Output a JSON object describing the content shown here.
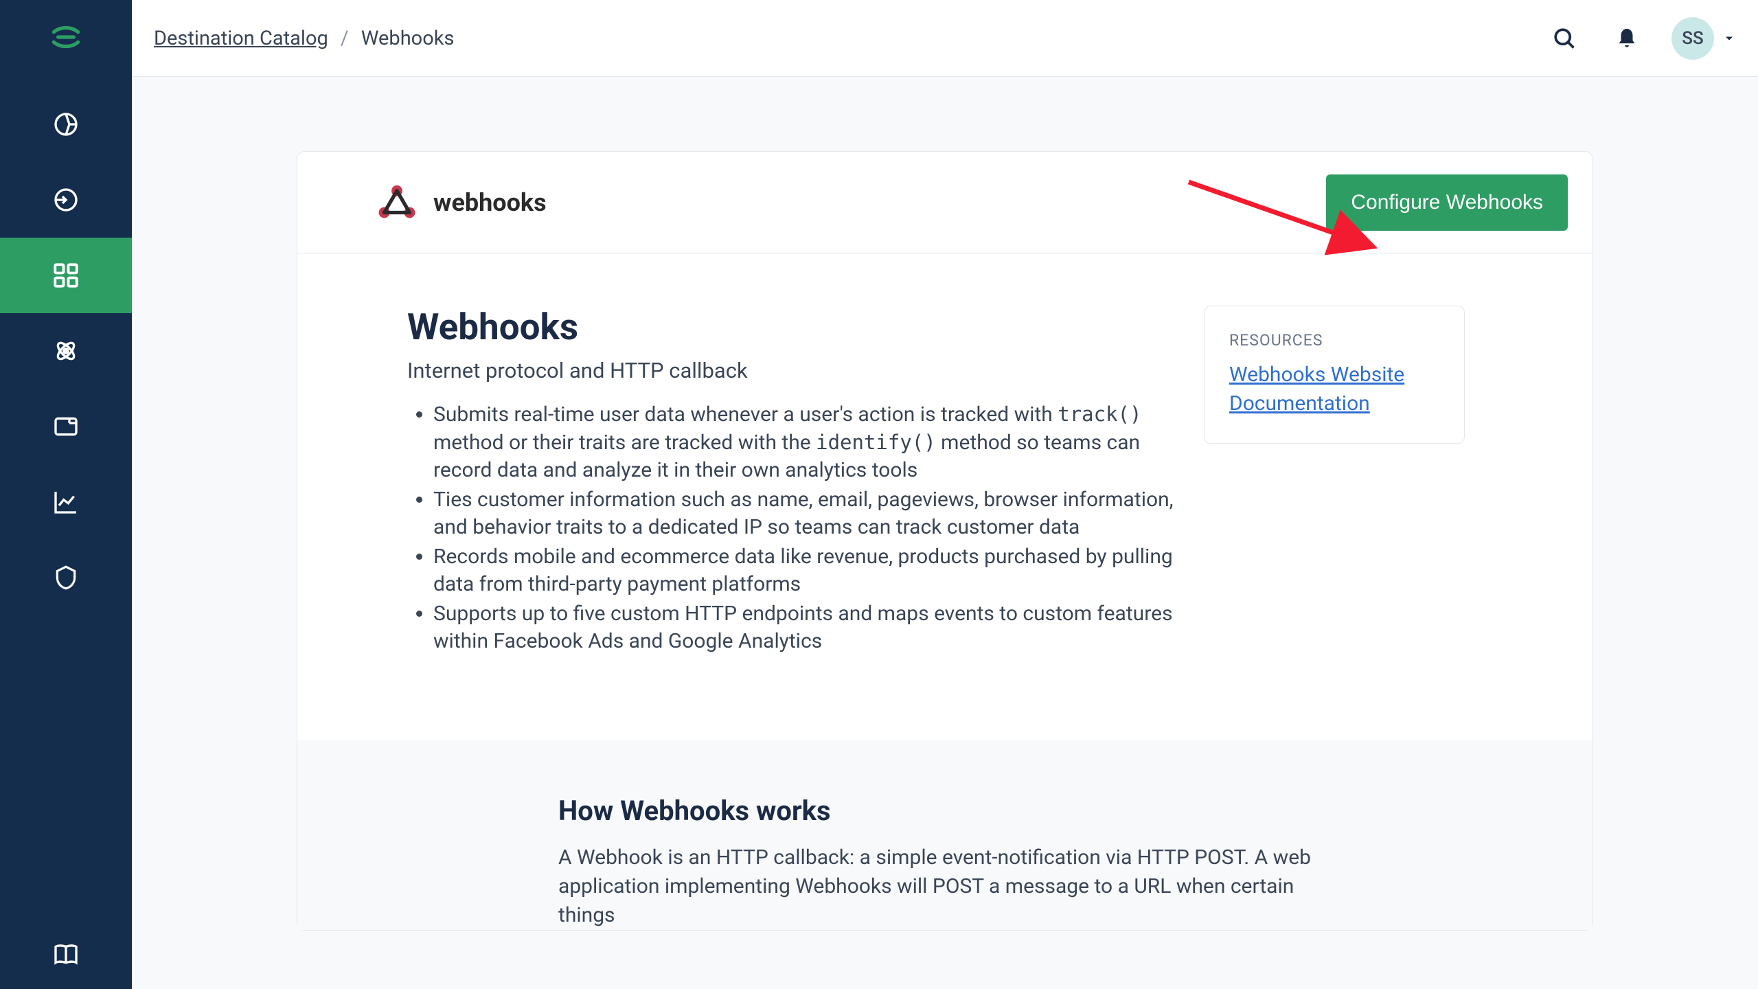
{
  "breadcrumb": {
    "link_text": "Destination Catalog",
    "separator": "/",
    "current": "Webhooks"
  },
  "topbar": {
    "avatar_initials": "SS"
  },
  "product": {
    "logo_text": "webhooks",
    "configure_label": "Configure Webhooks"
  },
  "description": {
    "heading": "Webhooks",
    "subtitle": "Internet protocol and HTTP callback",
    "bullets": {
      "b1_pre": "Submits real-time user data whenever a user's action is tracked with ",
      "b1_code1": "track()",
      "b1_mid": " method or their traits are tracked with the ",
      "b1_code2": "identify()",
      "b1_post": " method so teams can record data and analyze it in their own analytics tools",
      "b2": "Ties customer information such as name, email, pageviews, browser information, and behavior traits to a dedicated IP so teams can track customer data",
      "b3": "Records mobile and ecommerce data like revenue, products purchased by pulling data from third-party payment platforms",
      "b4": "Supports up to five custom HTTP endpoints and maps events to custom features within Facebook Ads and Google Analytics"
    }
  },
  "resources": {
    "label": "RESOURCES",
    "link": "Webhooks Website Documentation"
  },
  "how_it_works": {
    "heading": "How Webhooks works",
    "paragraph": "A Webhook is an HTTP callback: a simple event-notification via HTTP POST. A web application implementing Webhooks will POST a message to a URL when certain things"
  }
}
